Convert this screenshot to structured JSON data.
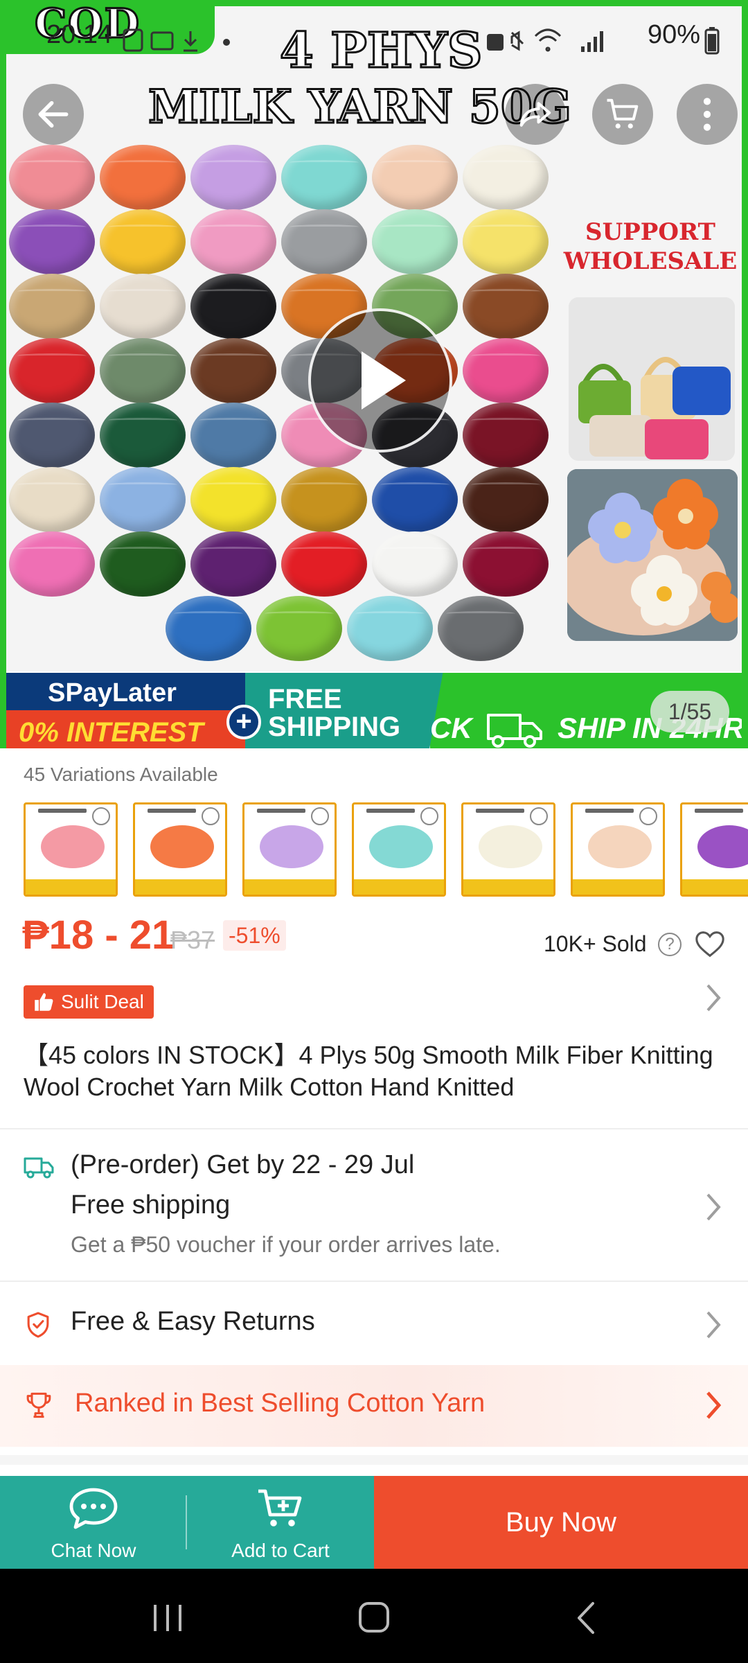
{
  "status_bar": {
    "time": "20:14",
    "battery": "90%"
  },
  "hero": {
    "badge": "COD",
    "title_line1": "4 PHYS",
    "title_line2": "MILK YARN 50G",
    "support": "SUPPORT WHOLESALE",
    "counter": "1/55",
    "promo": {
      "spaylater": "SPayLater",
      "interest": "0% INTEREST",
      "free_shipping": "FREE SHIPPING",
      "ship": "CK",
      "ship_24": "SHIP IN 24HR"
    },
    "yarn_colors": [
      "#f08c95",
      "#f2703d",
      "#c59ee3",
      "#7fd8d2",
      "#f3cdb3",
      "#f3efe2",
      "#8b4fb8",
      "#f6c22c",
      "#f09bc2",
      "#9a9da0",
      "#a8e6c4",
      "#f5e26a",
      "#c9a774",
      "#e6ddd0",
      "#1c1c1f",
      "#d97424",
      "#74a65a",
      "#8a4a26",
      "#d9252b",
      "#6e8a6a",
      "#6b3a23",
      "#7b7f84",
      "#c84a20",
      "#ea4d8e",
      "#4f5870",
      "#1b5a3a",
      "#4f7aa6",
      "#ef8cb6",
      "#2b2b30",
      "#7a1426",
      "#e8dcc6",
      "#8cb2e2",
      "#f3e22b",
      "#c6921e",
      "#1f4ea8",
      "#4a2318",
      "#ef6fb4",
      "#1f5c1f",
      "#5e2170",
      "#e31e25",
      "#f4f4f2",
      "#8c1032",
      "#2d6fc0",
      "#7dc334",
      "#86d6df",
      "#6a6d70"
    ]
  },
  "variations": {
    "label": "45 Variations Available",
    "thumb_colors": [
      "#f49aa4",
      "#f57a45",
      "#c8a6e8",
      "#84d9d4",
      "#f4f0de",
      "#f5d5bd",
      "#9a52c4"
    ]
  },
  "price": {
    "range": "₱18 - 21",
    "original": "₱37",
    "discount": "-51%",
    "sold": "10K+ Sold",
    "help": "?"
  },
  "deal": {
    "label": "Sulit Deal"
  },
  "product": {
    "title": "【45 colors IN STOCK】4 Plys 50g Smooth Milk Fiber Knitting Wool Crochet Yarn Milk Cotton Hand Knitted"
  },
  "shipping": {
    "preorder": "(Pre-order) Get by 22 - 29 Jul",
    "free": "Free shipping",
    "voucher": "Get a ₱50 voucher if your order arrives late."
  },
  "returns": {
    "label": "Free & Easy Returns"
  },
  "ranking": {
    "label": "Ranked in Best Selling Cotton Yarn"
  },
  "bottom_bar": {
    "chat": "Chat Now",
    "cart": "Add to Cart",
    "buy": "Buy Now"
  },
  "colors": {
    "accent": "#ee4d2d",
    "teal": "#26aa99",
    "green_frame": "#2bc22b"
  }
}
